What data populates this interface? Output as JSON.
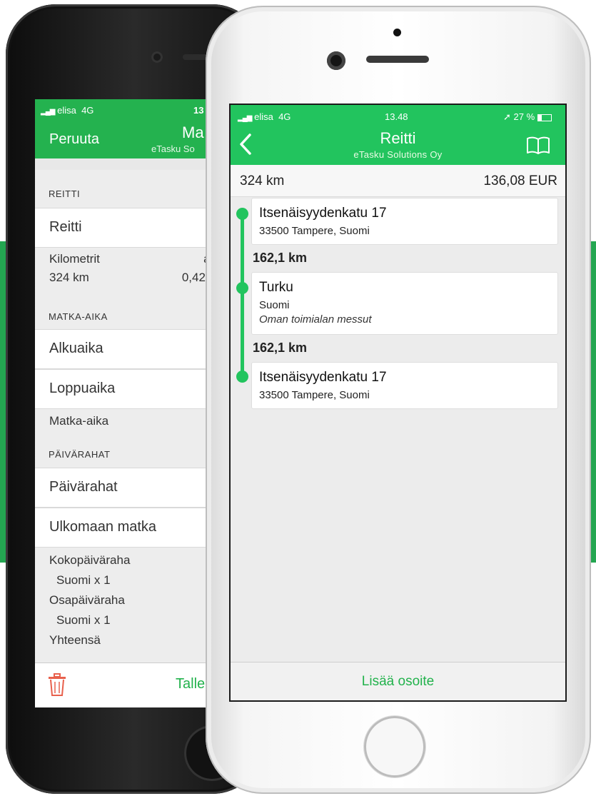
{
  "back_phone": {
    "status": {
      "carrier": "elisa",
      "network": "4G",
      "time": "13"
    },
    "nav": {
      "cancel": "Peruuta",
      "title": "Ma",
      "subtitle": "eTasku So"
    },
    "sections": {
      "route": "REITTI",
      "trip_time": "MATKA-AIKA",
      "allowances": "PÄIVÄRAHAT"
    },
    "rows": {
      "route": "Reitti",
      "start": "Alkuaika",
      "end": "Loppuaika",
      "allowances": "Päivärahat",
      "abroad": "Ulkomaan matka"
    },
    "kilometers": {
      "label": "Kilometrit",
      "value": "324 km",
      "rate_label": "á /",
      "rate_value": "0,42 E"
    },
    "trip_duration": "Matka-aika",
    "full_day": {
      "label": "Kokopäiväraha",
      "detail": "Suomi x 1"
    },
    "part_day": {
      "label": "Osapäiväraha",
      "detail": "Suomi x 1"
    },
    "total": "Yhteensä",
    "save": "Talle"
  },
  "front_phone": {
    "status": {
      "carrier": "elisa",
      "network": "4G",
      "time": "13.48",
      "battery": "27 %"
    },
    "nav": {
      "title": "Reitti",
      "subtitle": "eTasku Solutions Oy"
    },
    "summary": {
      "distance": "324 km",
      "cost": "136,08 EUR"
    },
    "stops": [
      {
        "name": "Itsenäisyydenkatu 17",
        "address": "33500 Tampere, Suomi"
      },
      {
        "name": "Turku",
        "address": "Suomi",
        "note": "Oman toimialan messut"
      },
      {
        "name": "Itsenäisyydenkatu 17",
        "address": "33500 Tampere, Suomi"
      }
    ],
    "legs": [
      "162,1 km",
      "162,1 km"
    ],
    "add_address": "Lisää osoite"
  },
  "colors": {
    "brand_green": "#22c45e",
    "band_green": "#24a651",
    "trash_red": "#e8604c"
  }
}
